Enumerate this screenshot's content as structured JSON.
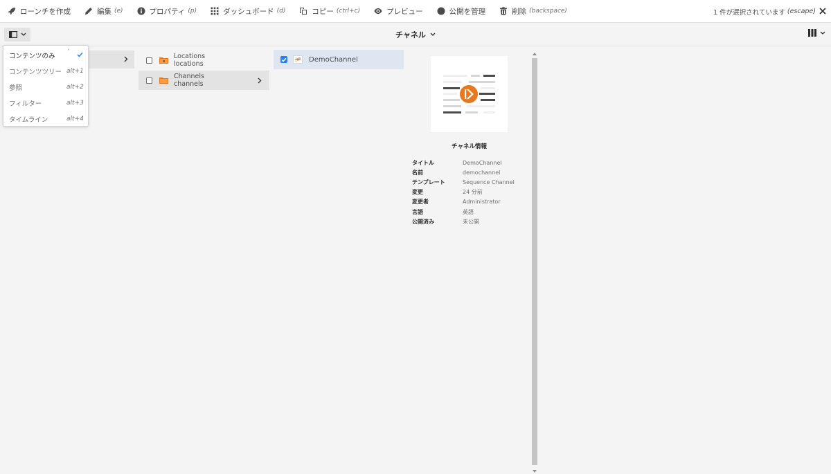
{
  "actions": [
    {
      "label": "ローンチを作成",
      "shortcut": "",
      "icon": "rocket-icon"
    },
    {
      "label": "編集",
      "shortcut": "(e)",
      "icon": "pencil-icon"
    },
    {
      "label": "プロパティ",
      "shortcut": "(p)",
      "icon": "info-icon"
    },
    {
      "label": "ダッシュボード",
      "shortcut": "(d)",
      "icon": "grid-icon"
    },
    {
      "label": "コピー",
      "shortcut": "(ctrl+c)",
      "icon": "copy-icon"
    },
    {
      "label": "プレビュー",
      "shortcut": "",
      "icon": "eye-icon"
    },
    {
      "label": "公開を管理",
      "shortcut": "",
      "icon": "globe-icon"
    },
    {
      "label": "削除",
      "shortcut": "(backspace)",
      "icon": "trash-icon"
    }
  ],
  "selection": {
    "text": "1 件が選択されています",
    "shortcut": "(escape)"
  },
  "header": {
    "title": "チャネル"
  },
  "rail_menu": [
    {
      "label": "コンテンツのみ",
      "shortcut": "`",
      "selected": true
    },
    {
      "label": "コンテンツツリー",
      "shortcut": "alt+1",
      "selected": false
    },
    {
      "label": "参照",
      "shortcut": "alt+2",
      "selected": false
    },
    {
      "label": "フィルター",
      "shortcut": "alt+3",
      "selected": false
    },
    {
      "label": "タイムライン",
      "shortcut": "alt+4",
      "selected": false
    }
  ],
  "column2": [
    {
      "title": "Locations",
      "name": "locations"
    },
    {
      "title": "Channels",
      "name": "channels"
    }
  ],
  "column3": [
    {
      "title": "DemoChannel",
      "checked": true
    }
  ],
  "meta": {
    "heading": "チャネル情報",
    "rows": [
      {
        "key": "タイトル",
        "value": "DemoChannel"
      },
      {
        "key": "名前",
        "value": "demochannel"
      },
      {
        "key": "テンプレート",
        "value": "Sequence Channel"
      },
      {
        "key": "変更",
        "value": "24 分前"
      },
      {
        "key": "変更者",
        "value": "Administrator"
      },
      {
        "key": "言語",
        "value": "英語"
      },
      {
        "key": "公開済み",
        "value": "未公開"
      }
    ]
  },
  "colors": {
    "accent": "#2680eb",
    "folder": "#e8781e",
    "selected_row": "#dde6f1"
  }
}
